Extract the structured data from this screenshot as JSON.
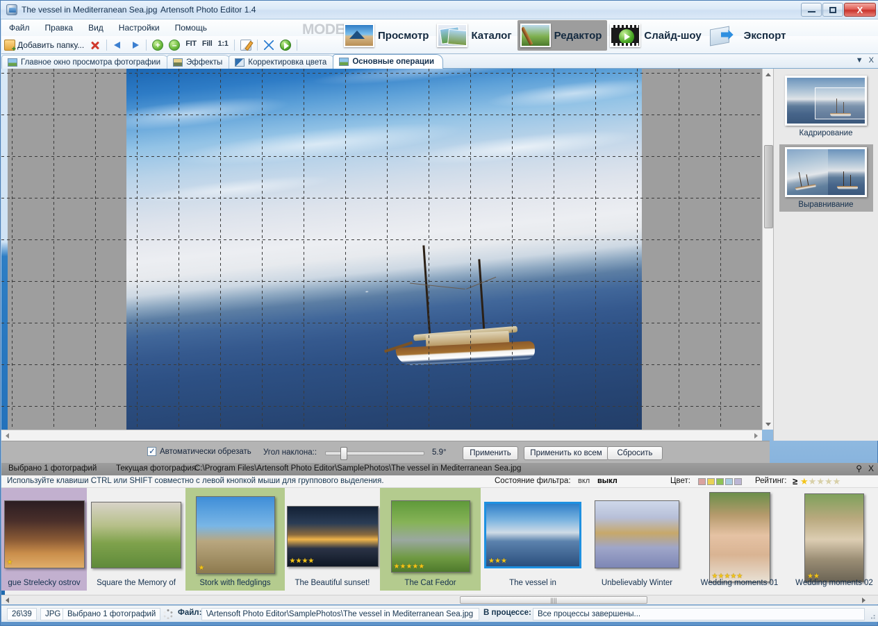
{
  "window": {
    "file_title": "The vessel in Mediterranean Sea.jpg",
    "app_title": "Artensoft Photo Editor 1.4",
    "minimize": "–",
    "maximize": "□",
    "close": "X"
  },
  "menu": {
    "items": [
      {
        "label": "Файл"
      },
      {
        "label": "Правка"
      },
      {
        "label": "Вид"
      },
      {
        "label": "Настройки"
      },
      {
        "label": "Помощь"
      }
    ]
  },
  "toolbar": {
    "add_folder": "Добавить папку...",
    "icons": [
      {
        "name": "folder-add-icon"
      },
      {
        "name": "delete-icon"
      },
      {
        "name": "previous-icon"
      },
      {
        "name": "next-icon"
      },
      {
        "name": "zoom-in-icon"
      },
      {
        "name": "zoom-out-icon"
      },
      {
        "name": "fit-icon",
        "text": "FIT"
      },
      {
        "name": "fill-icon",
        "text": "Fill"
      },
      {
        "name": "actual-size-icon",
        "text": "1:1"
      },
      {
        "name": "edit-icon"
      },
      {
        "name": "fullscreen-icon"
      },
      {
        "name": "slideshow-play-icon"
      }
    ]
  },
  "mode": {
    "label": "MODE:",
    "buttons": [
      {
        "label": "Просмотр",
        "active": false
      },
      {
        "label": "Каталог",
        "active": false
      },
      {
        "label": "Редактор",
        "active": true
      },
      {
        "label": "Слайд-шоу",
        "active": false
      },
      {
        "label": "Экспорт",
        "active": false
      }
    ]
  },
  "tabs": {
    "items": [
      {
        "label": "Главное окно просмотра фотографии",
        "active": false
      },
      {
        "label": "Эффекты",
        "active": false
      },
      {
        "label": "Корректировка цвета",
        "active": false
      },
      {
        "label": "Основные операции",
        "active": true
      }
    ],
    "dropdown": "▼",
    "close": "X"
  },
  "operations_panel": {
    "items": [
      {
        "label": "Кадрирование",
        "selected": false
      },
      {
        "label": "Выравнивание",
        "selected": true
      }
    ]
  },
  "rotate_bar": {
    "auto_crop_label": "Автоматически обрезать",
    "auto_crop_checked": true,
    "angle_label": "Угол наклона::",
    "angle_value": "5.9°",
    "angle_number": 5.9,
    "slider_percent": 16,
    "apply": "Применить",
    "apply_all": "Применить ко всем",
    "reset": "Сбросить"
  },
  "info_bar": {
    "selected_count": "Выбрано 1  фотографий",
    "current_label": "Текущая фотография:",
    "current_path": "C:\\Program Files\\Artensoft Photo Editor\\SamplePhotos\\The vessel in Mediterranean Sea.jpg",
    "pin": "⚲",
    "close": "X"
  },
  "hint_bar": {
    "hint": "Используйте клавиши CTRL или SHIFT совместно с левой кнопкой мыши для группового выделения.",
    "filter_state_label": "Состояние фильтра:",
    "filter_on": "вкл",
    "filter_off": "выкл",
    "color_label": "Цвет:",
    "color_swatches": [
      "#d9a3a0",
      "#e8d257",
      "#8fc355",
      "#a8cbe0",
      "#bcb6d4"
    ],
    "rating_label": "Рейтинг:",
    "rating_operator": "≥",
    "rating_value": 1,
    "rating_max": 5
  },
  "filmstrip": {
    "items": [
      {
        "caption": "gue Strelecky ostrov",
        "stars": 1,
        "highlight": "#c2b0cf",
        "selected": false
      },
      {
        "caption": "Square the Memory of",
        "stars": 0,
        "highlight": "none",
        "selected": false
      },
      {
        "caption": "Stork with fledglings",
        "stars": 1,
        "highlight": "#b4cb8e",
        "selected": false
      },
      {
        "caption": "The Beautiful sunset!",
        "stars": 4,
        "highlight": "none",
        "selected": false
      },
      {
        "caption": "The Cat Fedor",
        "stars": 5,
        "highlight": "#b4cb8e",
        "selected": false
      },
      {
        "caption": "The vessel in",
        "stars": 3,
        "highlight": "none",
        "selected": true
      },
      {
        "caption": "Unbelievably Winter",
        "stars": 0,
        "highlight": "none",
        "selected": false
      },
      {
        "caption": "Wedding moments 01",
        "stars": 5,
        "highlight": "none",
        "selected": false
      },
      {
        "caption": "Wedding moments 02",
        "stars": 2,
        "highlight": "none",
        "selected": false
      }
    ],
    "scroll_grip": "||||"
  },
  "status_bar": {
    "index": "26\\39",
    "format": "JPG",
    "selection": "Выбрано 1 фотографий",
    "file_label": "Файл:",
    "file_path": "\\Artensoft Photo Editor\\SamplePhotos\\The vessel in Mediterranean Sea.jpg",
    "process_label": "В процессе:",
    "process_value": "Все процессы завершены..."
  }
}
